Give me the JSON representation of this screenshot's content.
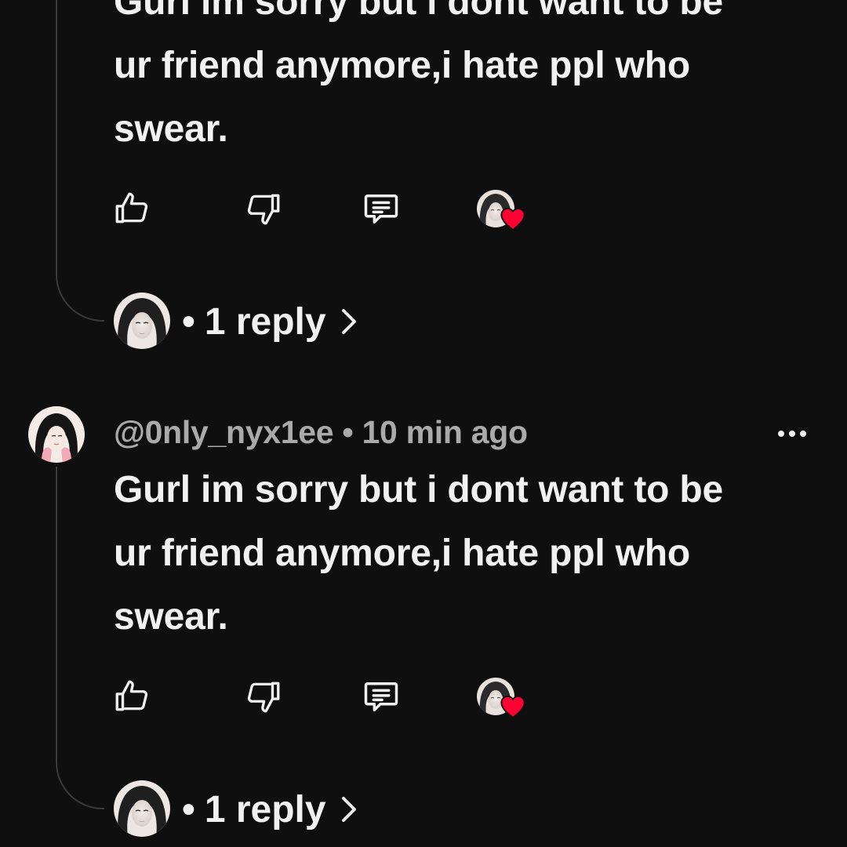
{
  "comments": [
    {
      "username": "",
      "timestamp": "",
      "text_lines": [
        "Gurl im sorry but i dont want to be",
        "ur friend anymore,i hate ppl who",
        "swear."
      ],
      "reply_count_label": "1 reply",
      "separator": "•"
    },
    {
      "username": "@0nly_nyx1ee",
      "timestamp": "10 min ago",
      "text_lines": [
        "Gurl im sorry but i dont want to be",
        "ur friend anymore,i hate ppl who",
        "swear."
      ],
      "reply_count_label": "1 reply",
      "separator": "•"
    }
  ],
  "icons": {
    "like": "thumbs-up-icon",
    "dislike": "thumbs-down-icon",
    "reply": "comment-icon",
    "hearted": "creator-heart-icon",
    "more": "more-options-icon",
    "expand": "chevron-right-icon"
  },
  "colors": {
    "background": "#0f0f0f",
    "text": "#f1f1f1",
    "meta": "#aaaaaa",
    "heart": "#ff0033",
    "thread_line": "#3a3a3a"
  }
}
